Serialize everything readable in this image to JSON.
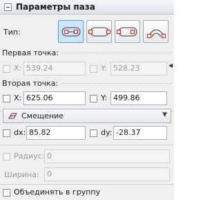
{
  "header": {
    "title": "Параметры паза"
  },
  "type_row": {
    "label": "Тип:",
    "buttons": [
      {
        "icon": "slot-center-points-icon",
        "active": true
      },
      {
        "icon": "slot-end-points-icon",
        "active": false
      },
      {
        "icon": "slot-overall-icon",
        "active": false
      },
      {
        "icon": "slot-arc-icon",
        "active": false
      }
    ]
  },
  "first_point": {
    "section_label": "Первая точка:",
    "x_label": "X:",
    "x_value": "539.24",
    "y_label": "Y:",
    "y_value": "528.23",
    "enabled": false
  },
  "second_point": {
    "section_label": "Вторая точка:",
    "x_label": "X:",
    "x_value": "625.06",
    "y_label": "Y:",
    "y_value": "499.86"
  },
  "mode_dropdown": {
    "value": "Смещение"
  },
  "offset": {
    "dx_label": "dx:",
    "dx_value": "85.82",
    "dy_label": "dy:",
    "dy_value": "-28.37"
  },
  "radius": {
    "label": "Радиус:",
    "value": "0",
    "enabled": false
  },
  "width": {
    "label": "Ширина:",
    "value": "0",
    "enabled": false
  },
  "group": {
    "label": "Объединять в группу"
  },
  "colors": {
    "accent": "#5b9bd5",
    "active_bg": "#cde6fb",
    "marker": "#d0312d"
  }
}
